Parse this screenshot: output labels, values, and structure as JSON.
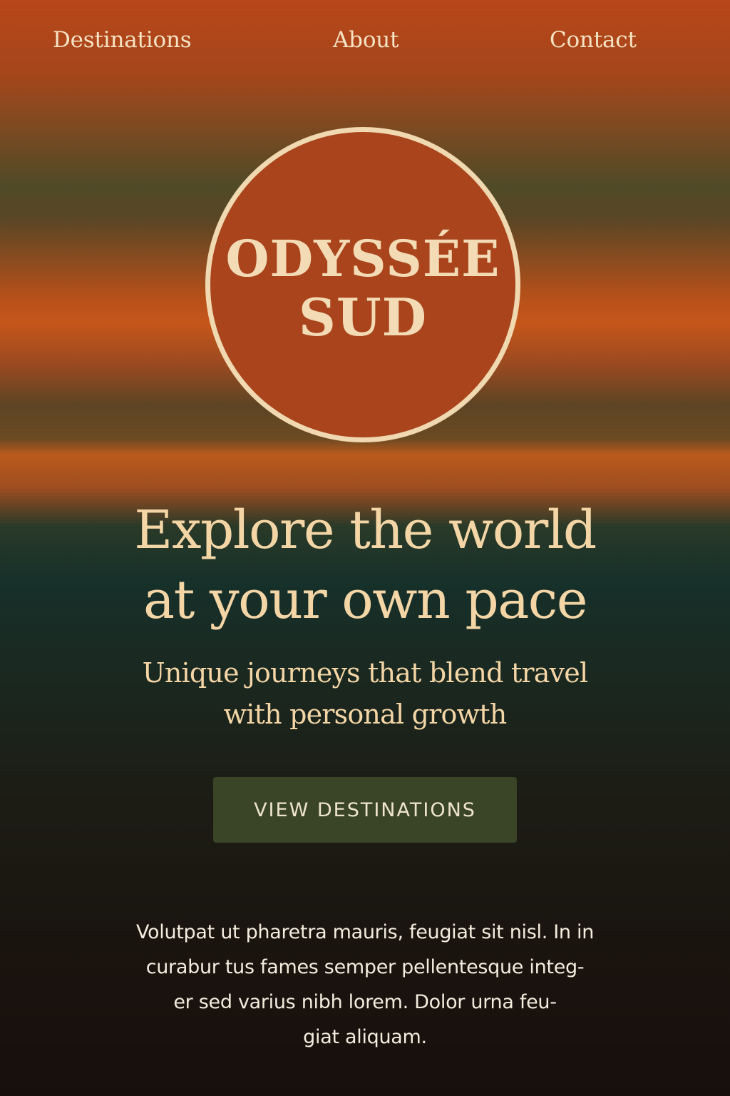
{
  "nav": {
    "items": [
      {
        "label": "Destinations"
      },
      {
        "label": "About"
      },
      {
        "label": "Contact"
      }
    ]
  },
  "logo": {
    "line1": "ODYSSÉE",
    "line2": "SUD"
  },
  "hero": {
    "headline_lines": [
      "Explore the world",
      "at your own pace"
    ],
    "subhead_lines": [
      "Unique journeys that blend travel",
      "with personal growth"
    ],
    "cta_label": "VIEW DESTINATIONS"
  },
  "body": {
    "lines": [
      "Volutpat ut pharetra mauris, feugiat sit nisl. In in",
      "curabur tus fames semper pellentesque integ-",
      "er sed varius nibh lorem. Dolor urna feu-",
      "giat aliquam."
    ]
  },
  "colors": {
    "accent_cream": "#f4d6a6",
    "logo_circle": "#a9441c",
    "button_bg": "#3a4426",
    "background_top": "#b8471a",
    "background_bottom": "#170f0b"
  }
}
